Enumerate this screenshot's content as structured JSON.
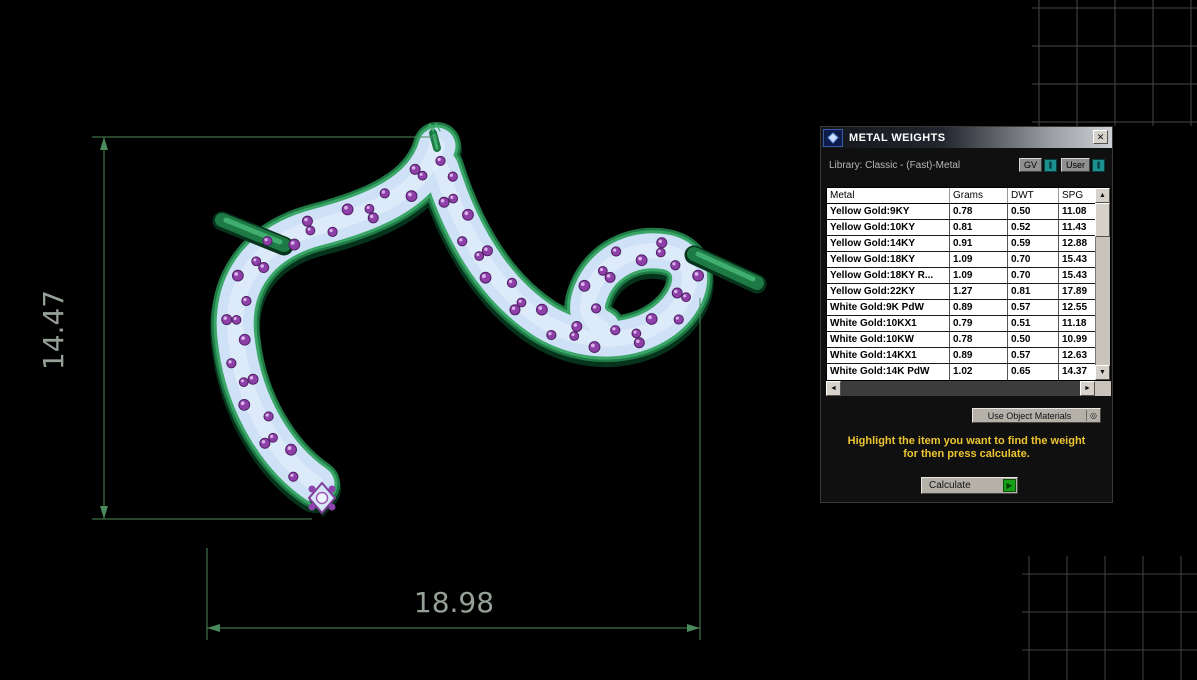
{
  "viewport": {
    "height_dim": "14.47",
    "width_dim": "18.98"
  },
  "icons": {
    "close": "✕",
    "scroll_up": "▲",
    "scroll_down": "▼",
    "scroll_left": "◄",
    "scroll_right": "►",
    "dropdown_target": "◎",
    "calculate_play": "▶",
    "gv_indicator": "❚",
    "user_indicator": "❚"
  },
  "dialog": {
    "title": "METAL WEIGHTS",
    "library_label": "Library: Classic - (Fast)-Metal",
    "gv_label": "GV",
    "user_label": "User",
    "table": {
      "headers": [
        "Metal",
        "Grams",
        "DWT",
        "SPG"
      ],
      "rows": [
        {
          "metal": "Yellow Gold:9KY",
          "grams": "0.78",
          "dwt": "0.50",
          "spg": "11.08"
        },
        {
          "metal": "Yellow Gold:10KY",
          "grams": "0.81",
          "dwt": "0.52",
          "spg": "11.43"
        },
        {
          "metal": "Yellow Gold:14KY",
          "grams": "0.91",
          "dwt": "0.59",
          "spg": "12.88"
        },
        {
          "metal": "Yellow Gold:18KY",
          "grams": "1.09",
          "dwt": "0.70",
          "spg": "15.43"
        },
        {
          "metal": "Yellow Gold:18KY R...",
          "grams": "1.09",
          "dwt": "0.70",
          "spg": "15.43"
        },
        {
          "metal": "Yellow Gold:22KY",
          "grams": "1.27",
          "dwt": "0.81",
          "spg": "17.89"
        },
        {
          "metal": "White Gold:9K PdW",
          "grams": "0.89",
          "dwt": "0.57",
          "spg": "12.55"
        },
        {
          "metal": "White Gold:10KX1",
          "grams": "0.79",
          "dwt": "0.51",
          "spg": "11.18"
        },
        {
          "metal": "White Gold:10KW",
          "grams": "0.78",
          "dwt": "0.50",
          "spg": "10.99"
        },
        {
          "metal": "White Gold:14KX1",
          "grams": "0.89",
          "dwt": "0.57",
          "spg": "12.63"
        },
        {
          "metal": "White Gold:14K PdW",
          "grams": "1.02",
          "dwt": "0.65",
          "spg": "14.37"
        }
      ]
    },
    "materials_dropdown": "Use Object Materials",
    "instruction_line1": "Highlight the item you want to find the weight",
    "instruction_line2": "for then press calculate.",
    "calculate_label": "Calculate"
  },
  "colors": {
    "instruction_yellow": "#edc531",
    "calculate_green": "#17a017",
    "toggle_teal": "#1d9090",
    "dimension_green": "#4a8a5c",
    "metal_green": "#1e7a44",
    "pave_blue": "#cfe1f6",
    "gem_purple": "#8e44ad"
  }
}
